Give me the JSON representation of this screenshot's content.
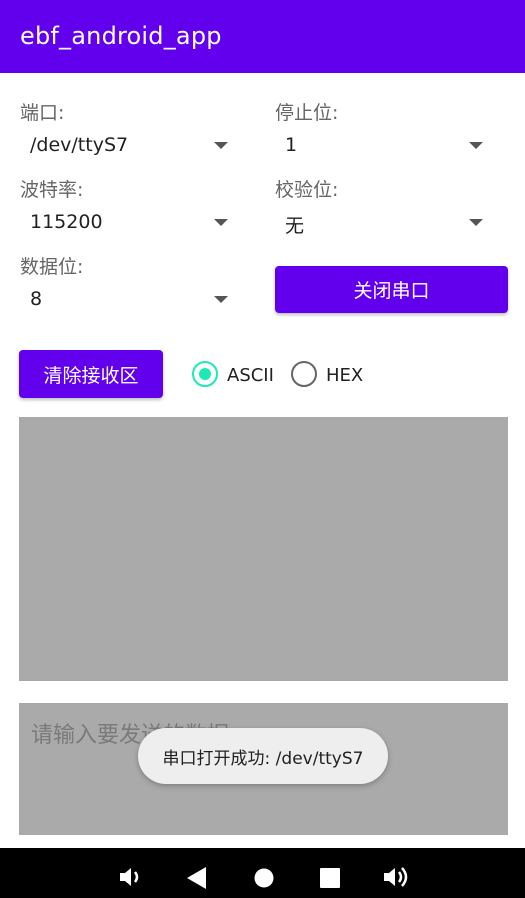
{
  "app": {
    "title": "ebf_android_app"
  },
  "settings": {
    "port": {
      "label": "端口:",
      "value": "/dev/ttyS7"
    },
    "stop_bits": {
      "label": "停止位:",
      "value": "1"
    },
    "baud_rate": {
      "label": "波特率:",
      "value": "115200"
    },
    "parity": {
      "label": "校验位:",
      "value": "无"
    },
    "data_bits": {
      "label": "数据位:",
      "value": "8"
    },
    "close_port_label": "关闭串口"
  },
  "receive": {
    "clear_label": "清除接收区",
    "mode_ascii": "ASCII",
    "mode_hex": "HEX",
    "selected_mode": "ASCII"
  },
  "send": {
    "placeholder": "请输入要发送的数据"
  },
  "toast": {
    "text": "串口打开成功: /dev/ttyS7"
  },
  "colors": {
    "primary": "#6200ee",
    "radio_accent": "#1de9b6",
    "text_area_bg": "#aaaaaa"
  },
  "navbar": {
    "icons": [
      "volume-down-icon",
      "back-icon",
      "home-icon",
      "recents-icon",
      "volume-up-icon"
    ]
  }
}
